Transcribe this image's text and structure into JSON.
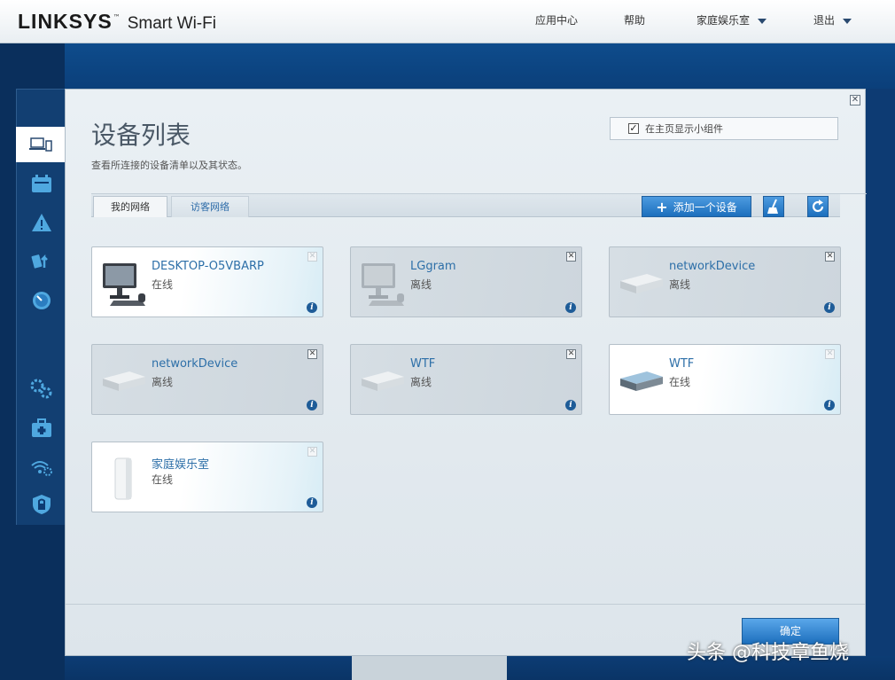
{
  "header": {
    "brand": "LINKSYS",
    "trademark": "™",
    "product": "Smart Wi-Fi",
    "nav": [
      {
        "label": "应用中心"
      },
      {
        "label": "帮助"
      },
      {
        "label": "家庭娱乐室"
      },
      {
        "label": "退出"
      }
    ]
  },
  "sidebar": {
    "back_icon": "chevron-left-icon",
    "icons": [
      "devices-icon",
      "parental-calendar-icon",
      "alert-icon",
      "media-priority-icon",
      "speed-test-icon",
      "settings-icon",
      "toolbox-icon",
      "wifi-settings-icon",
      "security-icon"
    ]
  },
  "modal": {
    "title": "设备列表",
    "subtitle": "查看所连接的设备清单以及其状态。",
    "show_widget_label": "在主页显示小组件",
    "show_widget_checked": true,
    "tabs": [
      {
        "label": "我的网络",
        "active": true
      },
      {
        "label": "访客网络",
        "active": false
      }
    ],
    "add_device_label": "添加一个设备",
    "add_icon": "plus-icon",
    "clean_icon": "broom-icon",
    "refresh_icon": "refresh-icon",
    "ok_label": "确定"
  },
  "devices": [
    {
      "name": "DESKTOP-O5VBARP",
      "status": "在线",
      "online": true,
      "icon": "desktop-computer-icon"
    },
    {
      "name": "LGgram",
      "status": "离线",
      "online": false,
      "icon": "desktop-computer-icon"
    },
    {
      "name": "networkDevice",
      "status": "离线",
      "online": false,
      "icon": "network-device-icon"
    },
    {
      "name": "networkDevice",
      "status": "离线",
      "online": false,
      "icon": "network-device-icon"
    },
    {
      "name": "WTF",
      "status": "离线",
      "online": false,
      "icon": "network-device-icon"
    },
    {
      "name": "WTF",
      "status": "在线",
      "online": true,
      "icon": "network-device-icon"
    },
    {
      "name": "家庭娱乐室",
      "status": "在线",
      "online": true,
      "icon": "velop-node-icon"
    }
  ],
  "watermark": "头条 @科技章鱼烧",
  "colors": {
    "background": "#0d3b73",
    "accent": "#1c6fbd",
    "link": "#2d6fa8"
  }
}
